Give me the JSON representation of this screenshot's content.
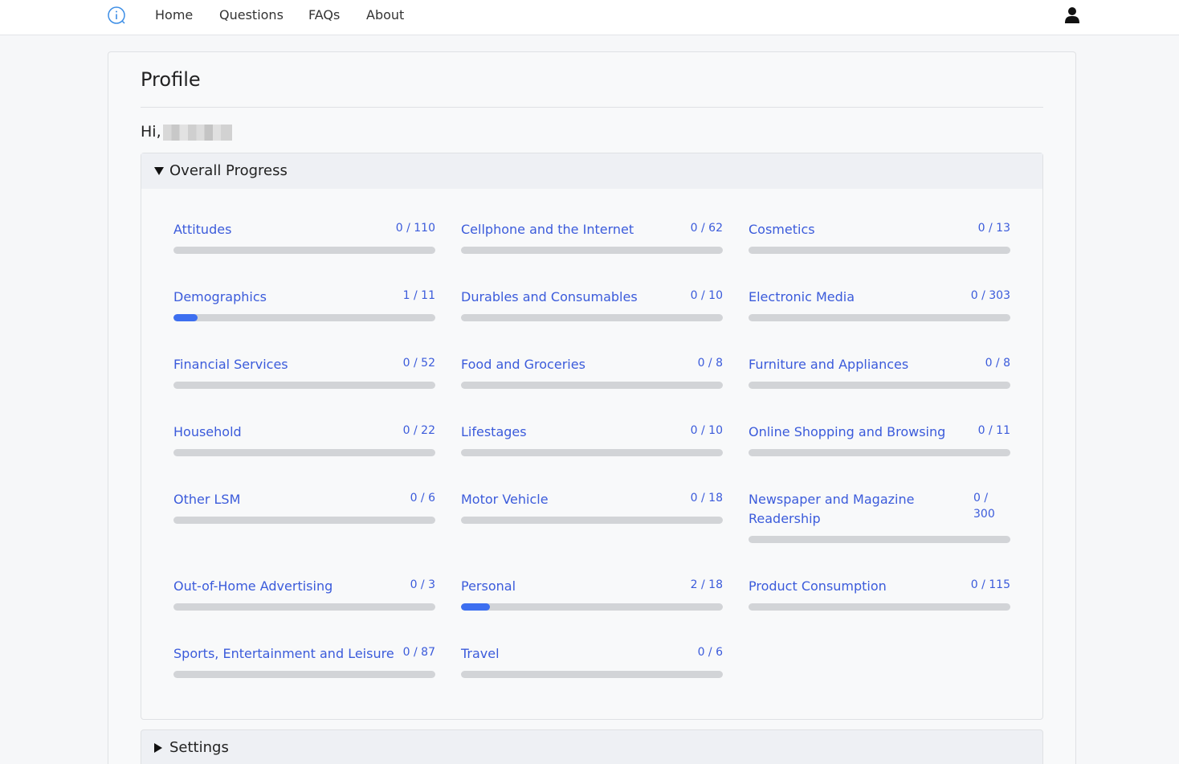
{
  "nav": {
    "logo_icon": "info-icon",
    "links": [
      "Home",
      "Questions",
      "FAQs",
      "About"
    ],
    "user_icon": "user-icon"
  },
  "profile": {
    "title": "Profile",
    "greeting": "Hi,"
  },
  "overall_progress": {
    "title": "Overall Progress",
    "categories": [
      {
        "name": "Attitudes",
        "count": "0 / 110",
        "progress": 0
      },
      {
        "name": "Cellphone and the Internet",
        "count": "0 / 62",
        "progress": 0
      },
      {
        "name": "Cosmetics",
        "count": "0 / 13",
        "progress": 0
      },
      {
        "name": "Demographics",
        "count": "1 / 11",
        "progress": 0.0909
      },
      {
        "name": "Durables and Consumables",
        "count": "0 / 10",
        "progress": 0
      },
      {
        "name": "Electronic Media",
        "count": "0 / 303",
        "progress": 0
      },
      {
        "name": "Financial Services",
        "count": "0 / 52",
        "progress": 0
      },
      {
        "name": "Food and Groceries",
        "count": "0 / 8",
        "progress": 0
      },
      {
        "name": "Furniture and Appliances",
        "count": "0 / 8",
        "progress": 0
      },
      {
        "name": "Household",
        "count": "0 / 22",
        "progress": 0
      },
      {
        "name": "Lifestages",
        "count": "0 / 10",
        "progress": 0
      },
      {
        "name": "Online Shopping and Browsing",
        "count": "0 / 11",
        "progress": 0
      },
      {
        "name": "Other LSM",
        "count": "0 / 6",
        "progress": 0
      },
      {
        "name": "Motor Vehicle",
        "count": "0 / 18",
        "progress": 0
      },
      {
        "name": "Newspaper and Magazine Readership",
        "count": "0 / 300",
        "progress": 0
      },
      {
        "name": "Out-of-Home Advertising",
        "count": "0 / 3",
        "progress": 0
      },
      {
        "name": "Personal",
        "count": "2 / 18",
        "progress": 0.1111
      },
      {
        "name": "Product Consumption",
        "count": "0 / 115",
        "progress": 0
      },
      {
        "name": "Sports, Entertainment and Leisure",
        "count": "0 / 87",
        "progress": 0
      },
      {
        "name": "Travel",
        "count": "0 / 6",
        "progress": 0
      }
    ]
  },
  "settings": {
    "title": "Settings"
  },
  "colors": {
    "accent": "#3d6ff0",
    "link": "#3b5bdb",
    "bar_bg": "#d2d4d7"
  }
}
